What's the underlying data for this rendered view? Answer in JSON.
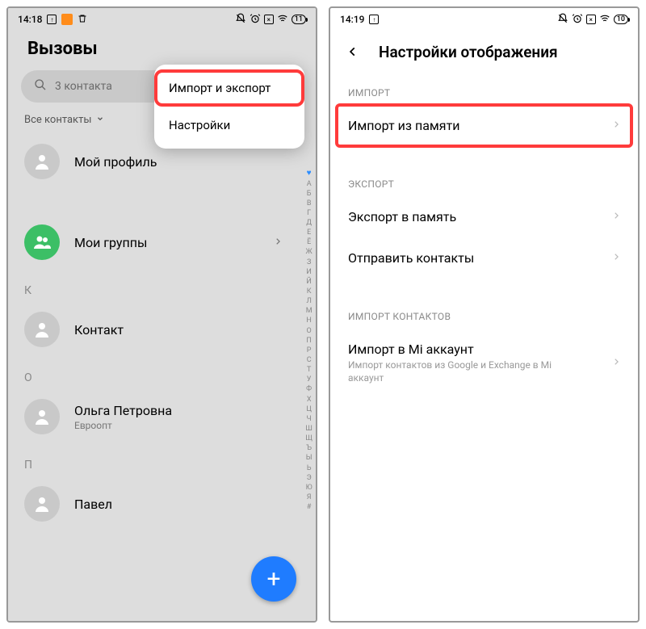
{
  "left": {
    "time": "14:18",
    "title": "Вызовы",
    "search_placeholder": "3 контакта",
    "filter_label": "Все контакты",
    "alpha_index": [
      "А",
      "Б",
      "В",
      "Г",
      "Д",
      "Е",
      "Ё",
      "Ж",
      "З",
      "И",
      "Й",
      "К",
      "Л",
      "М",
      "Н",
      "О",
      "П",
      "Р",
      "С",
      "Т",
      "У",
      "Ф",
      "Х",
      "Ц",
      "Ч",
      "Ш",
      "Щ",
      "Ъ",
      "Ы",
      "Ь",
      "Э",
      "Ю",
      "Я",
      "#"
    ],
    "menu": {
      "import_export": "Импорт и экспорт",
      "settings": "Настройки"
    },
    "rows": {
      "profile": "Мой профиль",
      "groups": "Мои группы",
      "letter_k": "К",
      "contact_k": "Контакт",
      "letter_o": "О",
      "olga_name": "Ольга Петровна",
      "olga_sub": "Евроопт",
      "letter_p": "П",
      "pavel": "Павел"
    },
    "battery": "11"
  },
  "right": {
    "time": "14:19",
    "title": "Настройки отображения",
    "battery": "10",
    "section_import": "ИМПОРТ",
    "import_from_memory": "Импорт из памяти",
    "section_export": "ЭКСПОРТ",
    "export_to_memory": "Экспорт в память",
    "send_contacts": "Отправить контакты",
    "section_import_contacts": "ИМПОРТ КОНТАКТОВ",
    "mi_import_title": "Импорт в Mi аккаунт",
    "mi_import_sub": "Импорт контактов из Google и Exchange в Mi аккаунт"
  }
}
